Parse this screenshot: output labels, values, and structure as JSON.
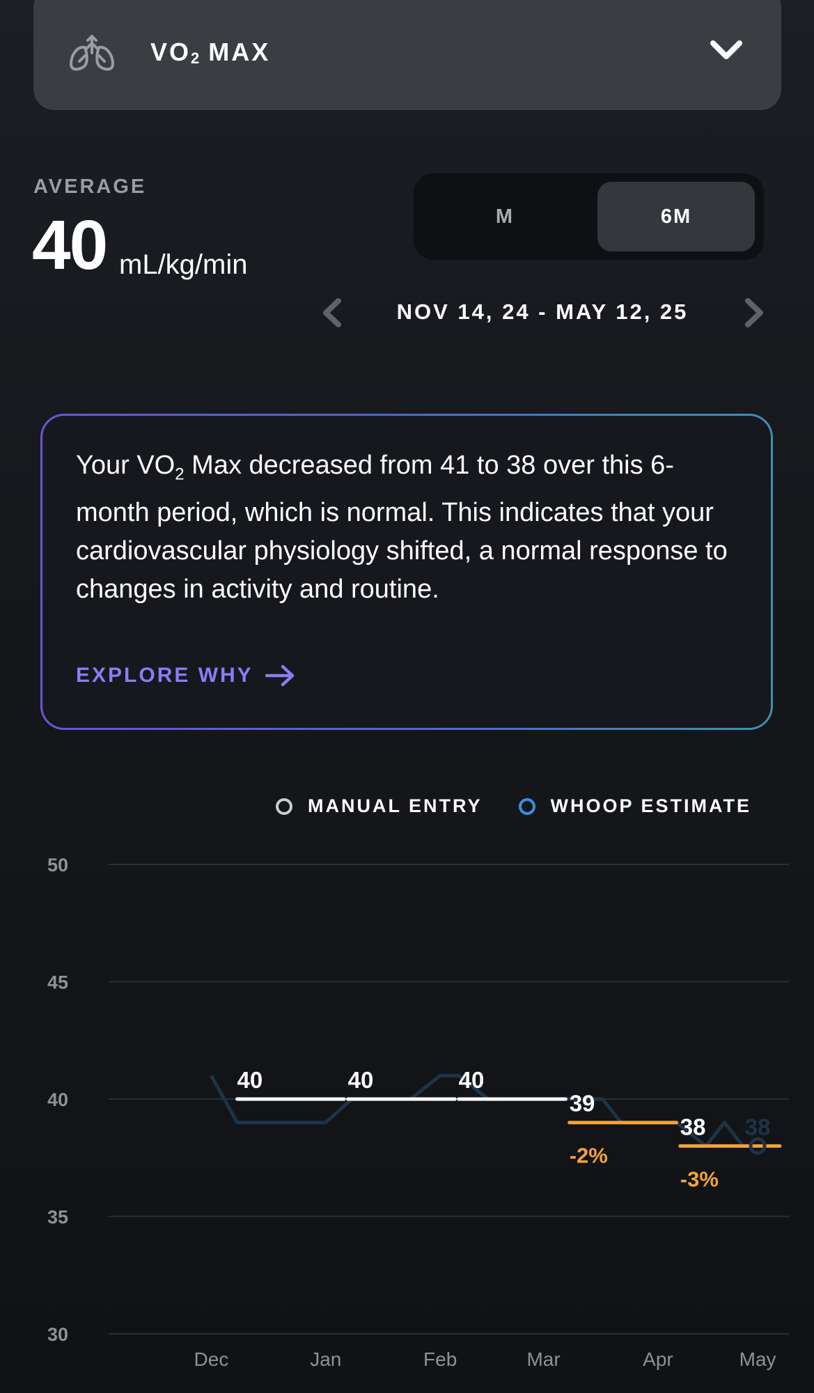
{
  "header": {
    "metric_title": "VO",
    "metric_sub": "2",
    "metric_title_rest": " MAX"
  },
  "summary": {
    "label": "AVERAGE",
    "value": "40",
    "unit": "mL/kg/min"
  },
  "range_toggle": {
    "options": [
      "M",
      "6M"
    ],
    "selected": "6M"
  },
  "date_range": "NOV 14, 24 - MAY 12, 25",
  "insight": {
    "text_before": "Your VO",
    "text_sub": "2",
    "text_after": " Max decreased from 41 to 38 over this 6-month period, which is normal. This indicates that your cardiovascular physiology shifted, a normal response to changes in activity and routine.",
    "link_label": "EXPLORE WHY"
  },
  "legend": {
    "manual": "MANUAL ENTRY",
    "whoop": "WHOOP ESTIMATE"
  },
  "colors": {
    "manual_dot": "#c9ccd1",
    "whoop_dot": "#3a8fe0",
    "decline": "#f2a33a",
    "estimate_line": "#1f3347"
  },
  "chart_data": {
    "type": "line",
    "ylim": [
      30,
      50
    ],
    "yticks": [
      50,
      45,
      40,
      35,
      30
    ],
    "grid": true,
    "x_labels": [
      "Dec",
      "Jan",
      "Feb",
      "Mar",
      "Apr",
      "May"
    ],
    "series": [
      {
        "name": "WHOOP ESTIMATE",
        "x": [
          "Dec 15",
          "Dec 22",
          "Jan 1",
          "Jan 15",
          "Jan 22",
          "Feb 1",
          "Feb 7",
          "Feb 15",
          "Feb 20",
          "Feb 28",
          "Mar 7",
          "Mar 15",
          "Mar 22",
          "Mar 31",
          "Apr 5",
          "Apr 12",
          "Apr 20",
          "Apr 28",
          "May 3",
          "May 8",
          "May 12"
        ],
        "values": [
          41,
          39,
          39,
          39,
          40,
          40,
          40,
          41,
          41,
          40,
          40,
          40,
          40,
          40,
          39,
          39,
          39,
          38,
          39,
          38,
          38
        ]
      }
    ],
    "weekly_averages": [
      {
        "label": "40",
        "value": 40,
        "start": "Dec 22",
        "end": "Jan 20",
        "change": ""
      },
      {
        "label": "40",
        "value": 40,
        "start": "Jan 21",
        "end": "Feb 19",
        "change": ""
      },
      {
        "label": "40",
        "value": 40,
        "start": "Feb 20",
        "end": "Mar 21",
        "change": ""
      },
      {
        "label": "39",
        "value": 39,
        "start": "Mar 22",
        "end": "Apr 20",
        "change": "-2%"
      },
      {
        "label": "38",
        "value": 38,
        "start": "Apr 21",
        "end": "May 18",
        "change": "-3%"
      }
    ],
    "latest_point": {
      "label": "38",
      "value": 38,
      "x": "May 12"
    }
  }
}
